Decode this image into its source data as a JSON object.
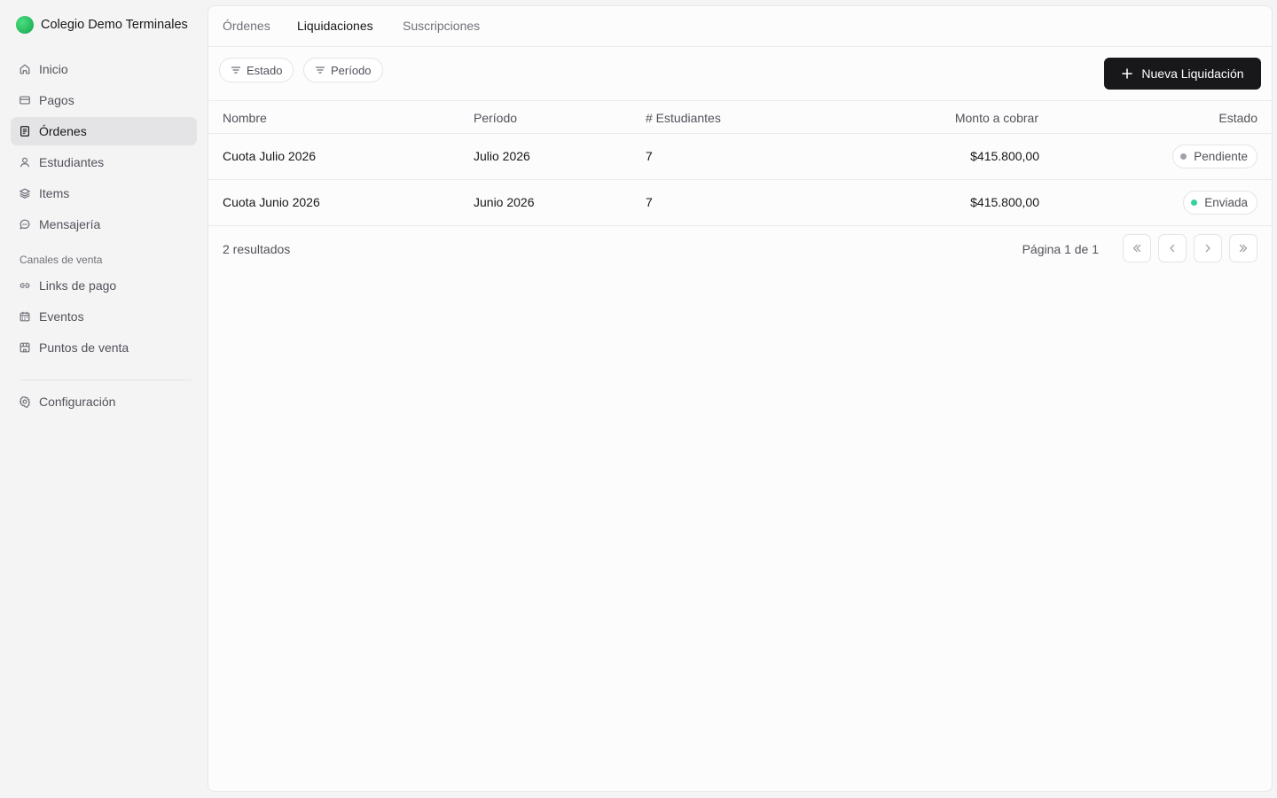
{
  "brand": {
    "name": "Colegio Demo Terminales",
    "accent": "#22c55e"
  },
  "sidebar": {
    "items": [
      {
        "label": "Inicio",
        "icon": "home-icon"
      },
      {
        "label": "Pagos",
        "icon": "credit-card-icon"
      },
      {
        "label": "Órdenes",
        "icon": "document-icon",
        "active": true
      },
      {
        "label": "Estudiantes",
        "icon": "user-icon"
      },
      {
        "label": "Items",
        "icon": "layers-icon"
      },
      {
        "label": "Mensajería",
        "icon": "message-icon"
      }
    ],
    "section_label": "Canales de venta",
    "channels": [
      {
        "label": "Links de pago",
        "icon": "link-icon"
      },
      {
        "label": "Eventos",
        "icon": "calendar-icon"
      },
      {
        "label": "Puntos de venta",
        "icon": "store-icon"
      }
    ],
    "settings": {
      "label": "Configuración",
      "icon": "gear-icon"
    }
  },
  "tabs": [
    {
      "label": "Órdenes"
    },
    {
      "label": "Liquidaciones",
      "active": true
    },
    {
      "label": "Suscripciones"
    }
  ],
  "filters": [
    {
      "label": "Estado",
      "icon": "filter-icon"
    },
    {
      "label": "Período",
      "icon": "filter-icon"
    }
  ],
  "primary_action": {
    "label": "Nueva Liquidación",
    "icon": "plus-icon"
  },
  "table": {
    "columns": [
      "Nombre",
      "Período",
      "# Estudiantes",
      "Monto a cobrar",
      "Estado"
    ],
    "rows": [
      {
        "nombre": "Cuota Julio 2026",
        "periodo": "Julio 2026",
        "estudiantes": "7",
        "monto": "$415.800,00",
        "estado": "Pendiente",
        "estado_color": "#a1a1aa"
      },
      {
        "nombre": "Cuota Junio 2026",
        "periodo": "Junio 2026",
        "estudiantes": "7",
        "monto": "$415.800,00",
        "estado": "Enviada",
        "estado_color": "#34d399"
      }
    ]
  },
  "footer": {
    "results": "2 resultados",
    "page_info": "Página 1 de 1"
  }
}
